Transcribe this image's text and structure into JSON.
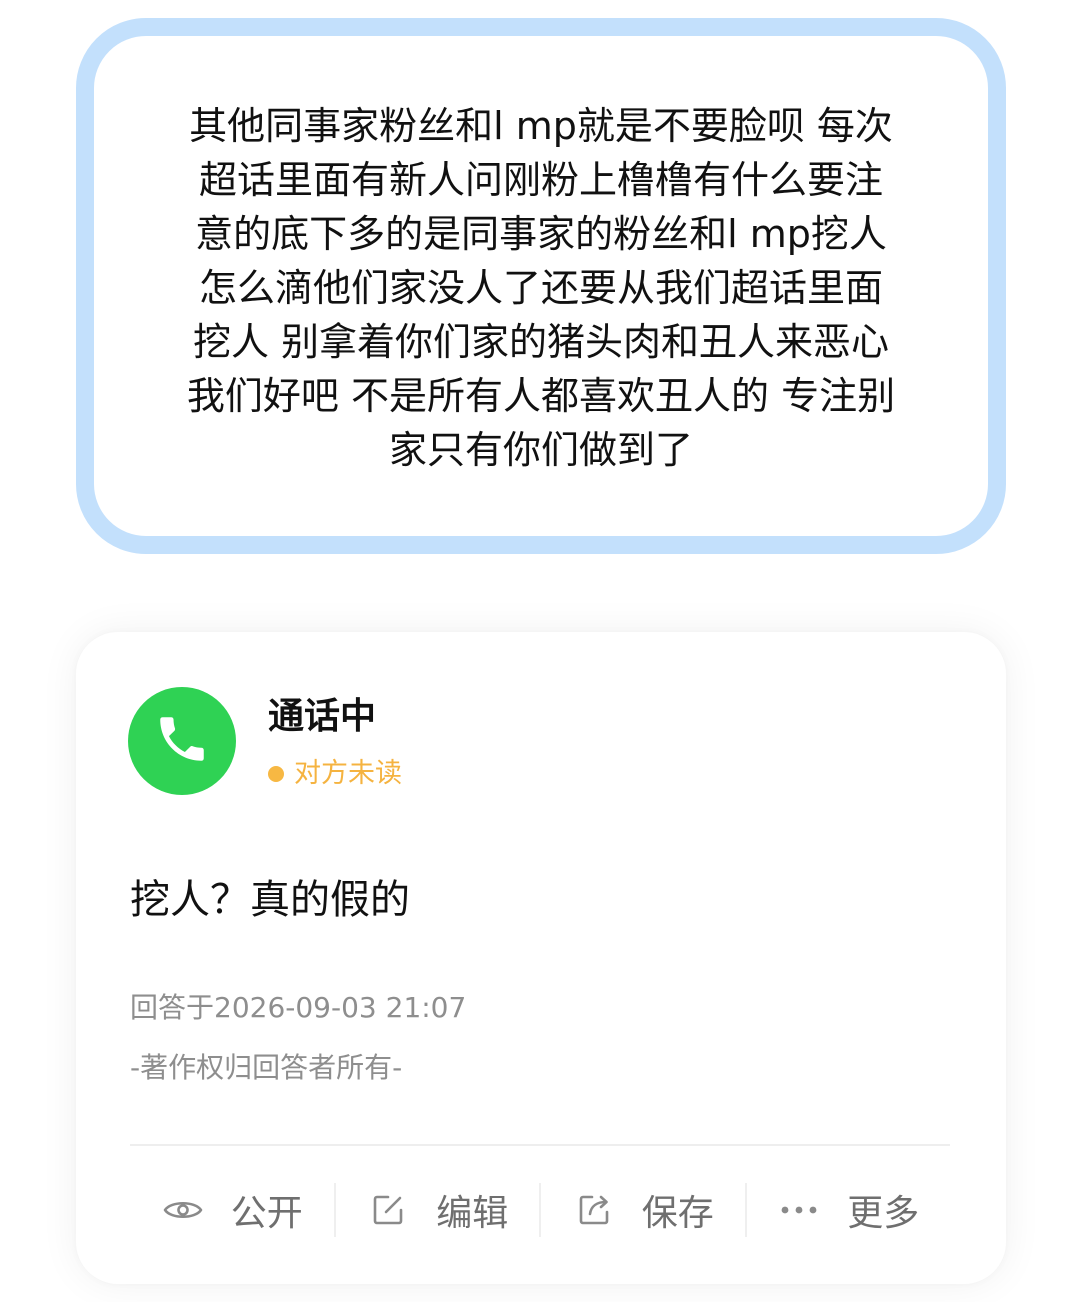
{
  "question": {
    "text": "其他同事家粉丝和l mp就是不要脸呗 每次\n超话里面有新人问刚粉上橹橹有什么要注\n意的底下多的是同事家的粉丝和l mp挖人\n怎么滴他们家没人了还要从我们超话里面\n挖人 别拿着你们家的猪头肉和丑人来恶心\n我们好吧 不是所有人都喜欢丑人的 专注别\n家只有你们做到了"
  },
  "answer": {
    "avatar_icon": "phone-icon",
    "name": "通话中",
    "status": "对方未读",
    "text": "挖人？真的假的",
    "time": "回答于2026-09-03 21:07",
    "copyright": "-著作权归回答者所有-"
  },
  "actions": [
    {
      "label": "公开",
      "icon": "eye-icon"
    },
    {
      "label": "编辑",
      "icon": "edit-icon"
    },
    {
      "label": "保存",
      "icon": "share-icon"
    },
    {
      "label": "更多",
      "icon": "more-icon"
    }
  ],
  "colors": {
    "bubble_border": "#c3e0fc",
    "avatar_green": "#2fd254",
    "status_orange": "#f5b340",
    "muted_text": "#8e8e8e"
  }
}
